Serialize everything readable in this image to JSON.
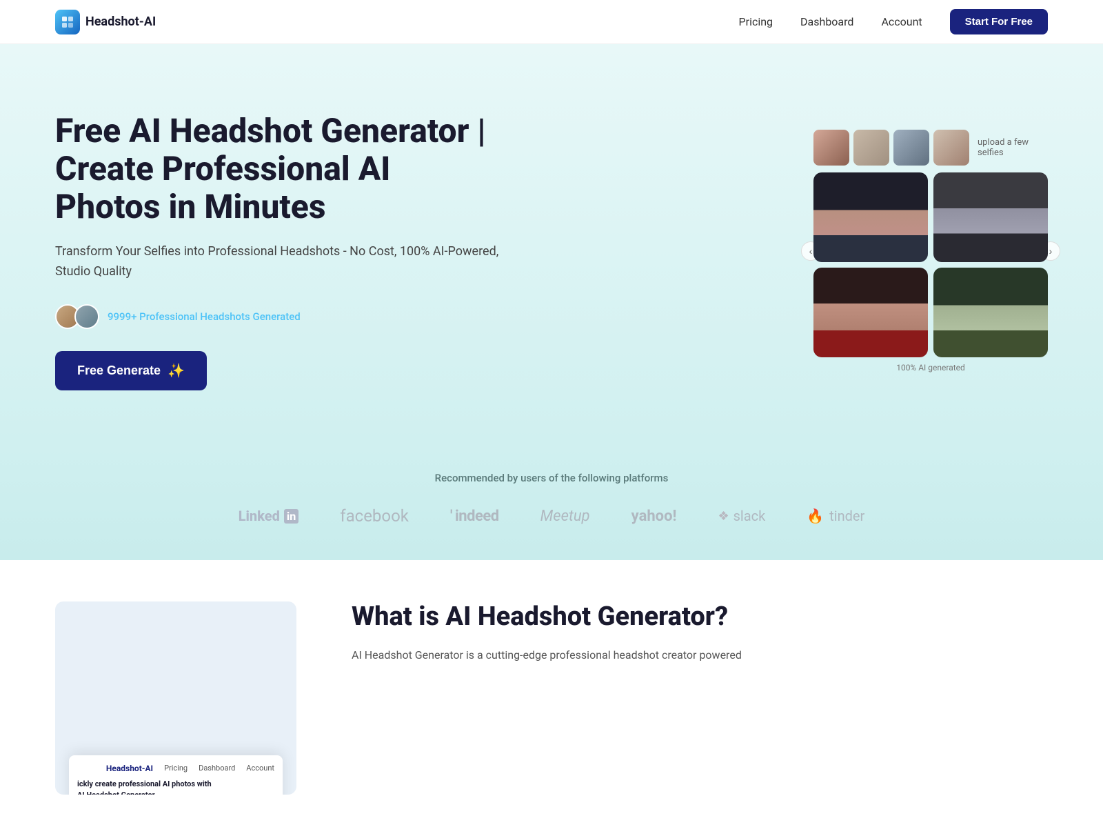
{
  "nav": {
    "logo_icon": "🤖",
    "logo_text": "Headshot-AI",
    "links": [
      {
        "label": "Pricing",
        "id": "pricing"
      },
      {
        "label": "Dashboard",
        "id": "dashboard"
      },
      {
        "label": "Account",
        "id": "account"
      }
    ],
    "cta_label": "Start For Free"
  },
  "hero": {
    "title": "Free AI Headshot Generator | Create Professional AI Photos in Minutes",
    "subtitle": "Transform Your Selfies into Professional Headshots - No Cost, 100% AI-Powered, Studio Quality",
    "social_proof_text": "9999+ Professional Headshots Generated",
    "cta_label": "Free Generate",
    "selfie_label": "upload a few selfies",
    "ai_label": "100% AI generated"
  },
  "platforms": {
    "title": "Recommended by users of the following platforms",
    "logos": [
      {
        "name": "LinkedIn",
        "id": "linkedin"
      },
      {
        "name": "facebook",
        "id": "facebook"
      },
      {
        "name": "indeed",
        "id": "indeed"
      },
      {
        "name": "Meetup",
        "id": "meetup"
      },
      {
        "name": "yahoo!",
        "id": "yahoo"
      },
      {
        "name": "slack",
        "id": "slack"
      },
      {
        "name": "tinder",
        "id": "tinder"
      }
    ]
  },
  "bottom": {
    "screenshot_nav_logo": "Headshot-AI",
    "screenshot_nav_links": [
      "Pricing",
      "Dashboard",
      "Account"
    ],
    "screenshot_text": "ickly create professional AI photos with\nAI Headshot Generator",
    "what_is_title": "What is AI Headshot Generator?",
    "what_is_text": "AI Headshot Generator is a cutting-edge professional headshot creator powered"
  }
}
